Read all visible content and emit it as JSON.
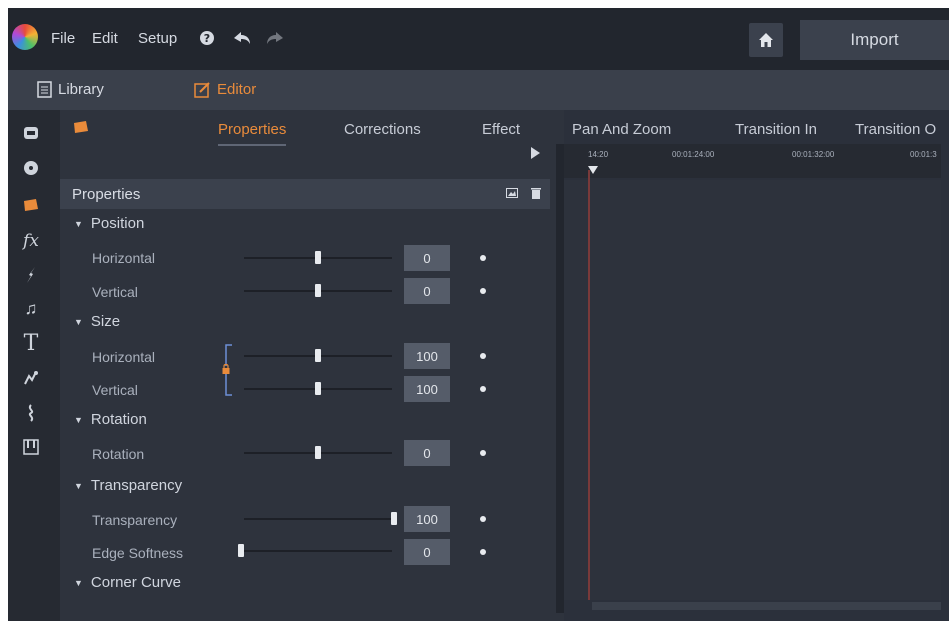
{
  "menu": {
    "items": [
      "File",
      "Edit",
      "Setup"
    ],
    "import_label": "Import"
  },
  "nav": {
    "library_label": "Library",
    "editor_label": "Editor"
  },
  "tabs": [
    "Properties",
    "Corrections",
    "Effect",
    "Pan And Zoom",
    "Transition In",
    "Transition O"
  ],
  "active_tab": "Properties",
  "timeline": {
    "timecodes": [
      "14:20",
      "00:01:24:00",
      "00:01:32:00",
      "00:01:3"
    ]
  },
  "properties": {
    "title": "Properties",
    "sections": {
      "position": "Position",
      "size": "Size",
      "rotation": "Rotation",
      "transparency": "Transparency",
      "corner_curve": "Corner Curve"
    },
    "rows": {
      "pos_h": {
        "label": "Horizontal",
        "value": "0"
      },
      "pos_v": {
        "label": "Vertical",
        "value": "0"
      },
      "size_h": {
        "label": "Horizontal",
        "value": "100"
      },
      "size_v": {
        "label": "Vertical",
        "value": "100"
      },
      "rot": {
        "label": "Rotation",
        "value": "0"
      },
      "transp": {
        "label": "Transparency",
        "value": "100"
      },
      "edge": {
        "label": "Edge Softness",
        "value": "0"
      }
    }
  },
  "colors": {
    "accent": "#e98b3b",
    "background": "#2b303b",
    "panel": "#2e333d"
  },
  "icons": [
    "home-icon",
    "help-icon",
    "undo-icon",
    "redo-icon",
    "play-icon",
    "lock-icon"
  ]
}
